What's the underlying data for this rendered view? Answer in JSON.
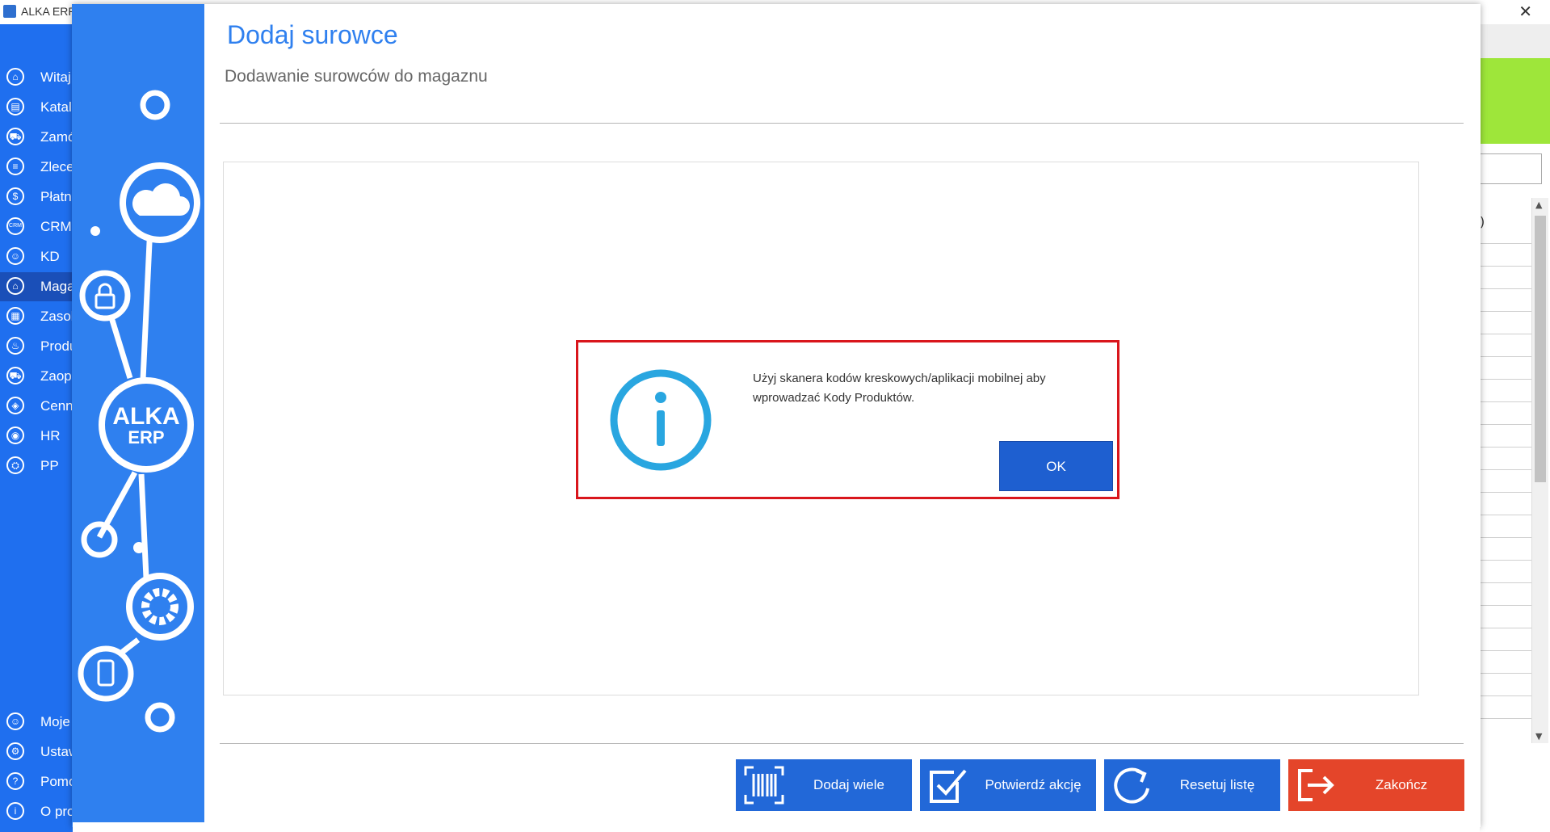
{
  "background_window": {
    "title": "ALKA ERP",
    "sidebar": {
      "items": [
        {
          "label": "Witaj",
          "icon": "home-icon"
        },
        {
          "label": "Katalo",
          "icon": "book-icon"
        },
        {
          "label": "Zamó",
          "icon": "cart-icon"
        },
        {
          "label": "Zlece",
          "icon": "list-icon"
        },
        {
          "label": "Płatno",
          "icon": "dollar-icon"
        },
        {
          "label": "CRM",
          "icon": "crm-icon"
        },
        {
          "label": "KD",
          "icon": "person-icon"
        },
        {
          "label": "Maga",
          "icon": "warehouse-icon",
          "active": true
        },
        {
          "label": "Zasob",
          "icon": "resources-icon"
        },
        {
          "label": "Produ",
          "icon": "production-icon"
        },
        {
          "label": "Zaop",
          "icon": "truck-icon"
        },
        {
          "label": "Cenn",
          "icon": "tag-icon"
        },
        {
          "label": "HR",
          "icon": "hr-icon"
        },
        {
          "label": "PP",
          "icon": "pp-icon"
        }
      ],
      "bottom_items": [
        {
          "label": "Moje",
          "icon": "user-icon"
        },
        {
          "label": "Ustaw",
          "icon": "settings-icon"
        },
        {
          "label": "Pomo",
          "icon": "help-icon"
        },
        {
          "label": "O pro",
          "icon": "info-icon"
        }
      ]
    },
    "right_table_header": ")",
    "accent_green": "#9ee63a"
  },
  "dialog": {
    "title": "Dodaj surowce",
    "subtitle": "Dodawanie surowców do magaznu",
    "logo_text_top": "ALKA",
    "logo_text_bottom": "ERP",
    "accent_color": "#2f80ef",
    "buttons": {
      "add_many": "Dodaj wiele",
      "confirm": "Potwierdź akcję",
      "reset": "Resetuj listę",
      "finish": "Zakończ"
    }
  },
  "message_box": {
    "text": "Użyj skanera kodów kreskowych/aplikacji mobilnej aby wprowadzać Kody Produktów.",
    "ok_label": "OK",
    "border_color": "#d9161c"
  }
}
